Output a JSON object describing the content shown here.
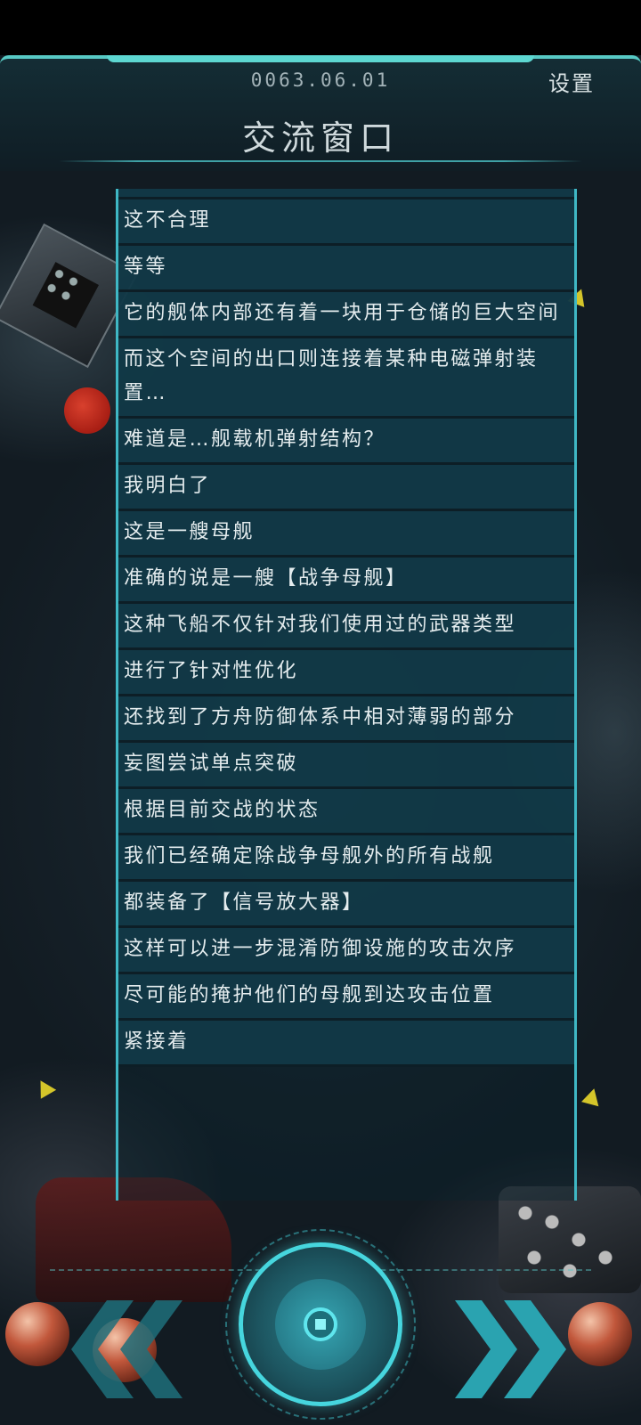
{
  "header": {
    "date": "0063.06.01",
    "settings_label": "设置",
    "title": "交流窗口"
  },
  "messages": [
    "这不合理",
    "等等",
    "它的舰体内部还有着一块用于仓储的巨大空间",
    "而这个空间的出口则连接着某种电磁弹射装置…",
    "难道是…舰载机弹射结构？",
    "我明白了",
    "这是一艘母舰",
    "准确的说是一艘【战争母舰】",
    "这种飞船不仅针对我们使用过的武器类型",
    "进行了针对性优化",
    "还找到了方舟防御体系中相对薄弱的部分",
    "妄图尝试单点突破",
    "根据目前交战的状态",
    "我们已经确定除战争母舰外的所有战舰",
    "都装备了【信号放大器】",
    "这样可以进一步混淆防御设施的攻击次序",
    "尽可能的掩护他们的母舰到达攻击位置",
    "紧接着"
  ],
  "colors": {
    "accent": "#46d6de",
    "panel": "#113948",
    "text": "#e4ecee"
  },
  "controls": {
    "prev_icon": "double-chevron-left-icon",
    "next_icon": "double-chevron-right-icon",
    "center_icon": "record-button-icon"
  }
}
